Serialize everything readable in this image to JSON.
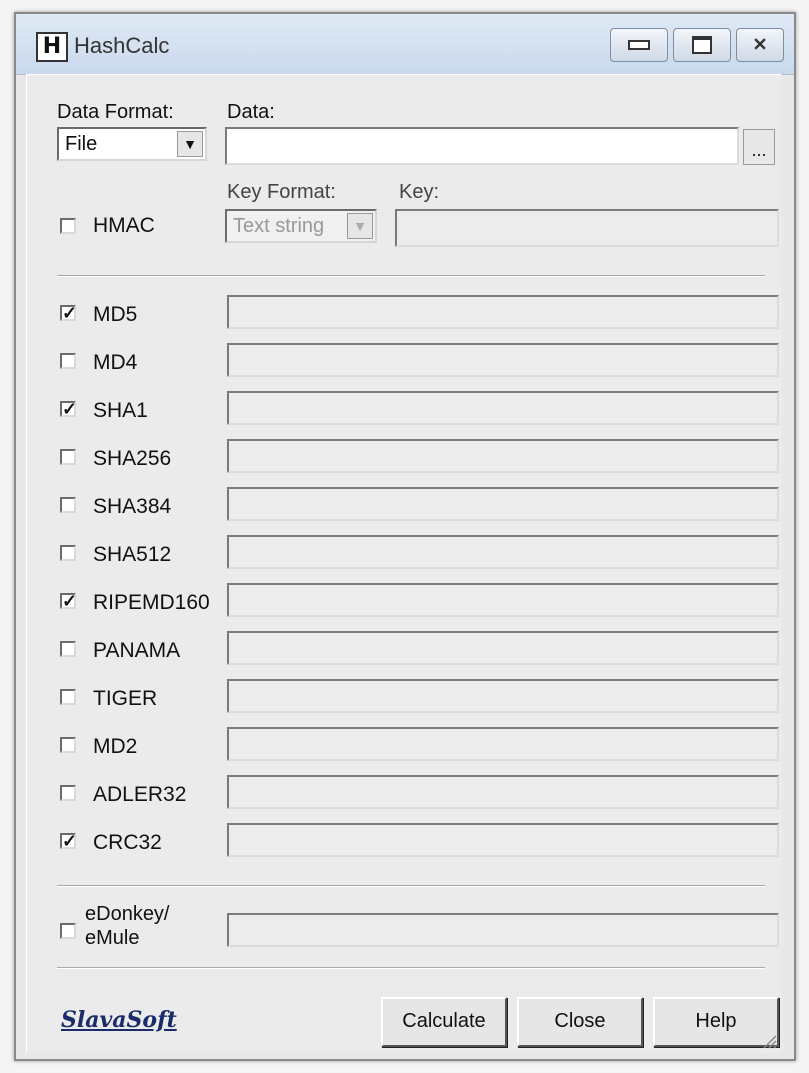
{
  "window": {
    "title": "HashCalc",
    "app_icon_letter": "H"
  },
  "data_format": {
    "label": "Data Format:",
    "value": "File"
  },
  "data": {
    "label": "Data:",
    "value": "",
    "browse_label": "..."
  },
  "hmac": {
    "label": "HMAC",
    "checked": false
  },
  "key_format": {
    "label": "Key Format:",
    "value": "Text string",
    "enabled": false
  },
  "key": {
    "label": "Key:",
    "value": ""
  },
  "hashes": [
    {
      "name": "MD5",
      "checked": true,
      "value": ""
    },
    {
      "name": "MD4",
      "checked": false,
      "value": ""
    },
    {
      "name": "SHA1",
      "checked": true,
      "value": ""
    },
    {
      "name": "SHA256",
      "checked": false,
      "value": ""
    },
    {
      "name": "SHA384",
      "checked": false,
      "value": ""
    },
    {
      "name": "SHA512",
      "checked": false,
      "value": ""
    },
    {
      "name": "RIPEMD160",
      "checked": true,
      "value": ""
    },
    {
      "name": "PANAMA",
      "checked": false,
      "value": ""
    },
    {
      "name": "TIGER",
      "checked": false,
      "value": ""
    },
    {
      "name": "MD2",
      "checked": false,
      "value": ""
    },
    {
      "name": "ADLER32",
      "checked": false,
      "value": ""
    },
    {
      "name": "CRC32",
      "checked": true,
      "value": ""
    }
  ],
  "edonkey": {
    "line1": "eDonkey/",
    "line2": "eMule",
    "checked": false,
    "value": ""
  },
  "footer": {
    "logo": "SlavaSoft",
    "calculate_label": "Calculate",
    "close_label": "Close",
    "help_label": "Help"
  }
}
